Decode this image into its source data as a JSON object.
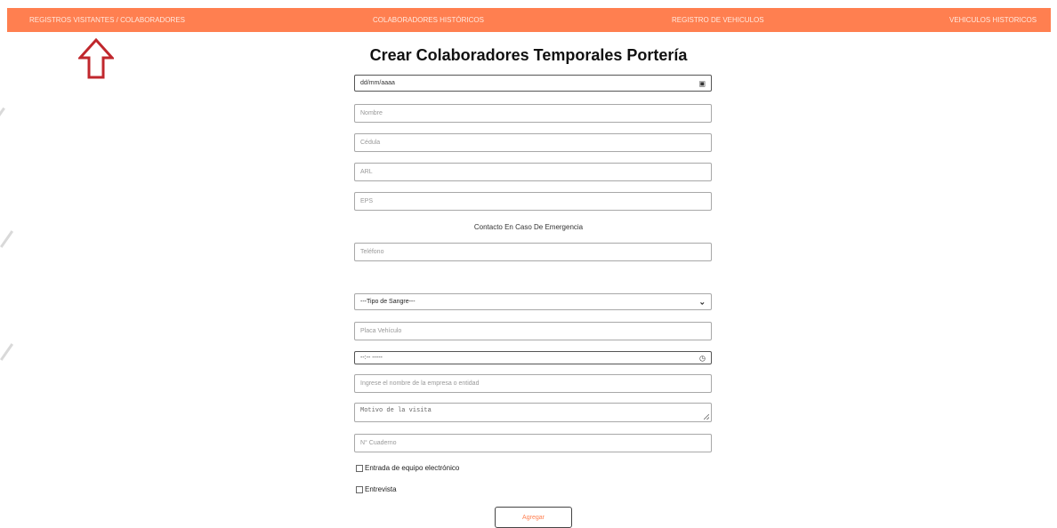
{
  "nav": {
    "items": [
      {
        "label": "REGISTROS VISITANTES / COLABORADORES"
      },
      {
        "label": "COLABORADORES HISTÓRICOS"
      },
      {
        "label": "REGISTRO DE VEHICULOS"
      },
      {
        "label": "VEHICULOS HISTORICOS"
      }
    ],
    "bar_color": "#ff7f50"
  },
  "annotation": {
    "icon": "up-arrow-outline-icon",
    "color": "#c0272d"
  },
  "form": {
    "title": "Crear Colaboradores Temporales Portería",
    "date_value": "dd/mm/aaaa",
    "name_placeholder": "Nombre",
    "id_placeholder": "Cédula",
    "arl_placeholder": "ARL",
    "eps_placeholder": "EPS",
    "emergency_label": "Contacto En Caso De Emergencia",
    "phone_placeholder": "Teléfono",
    "blood_select_value": "---Tipo de Sangre---",
    "plate_placeholder": "Placa Vehículo",
    "time_value": "--:-- -----",
    "company_placeholder": "Ingrese el nombre de la empresa o entidad",
    "reason_placeholder": "Motivo de la visita",
    "notebook_placeholder": "N° Cuaderno",
    "electronic_label": "Entrada de equipo electrónico",
    "interview_label": "Entrevista",
    "submit_label": "Agregar"
  }
}
